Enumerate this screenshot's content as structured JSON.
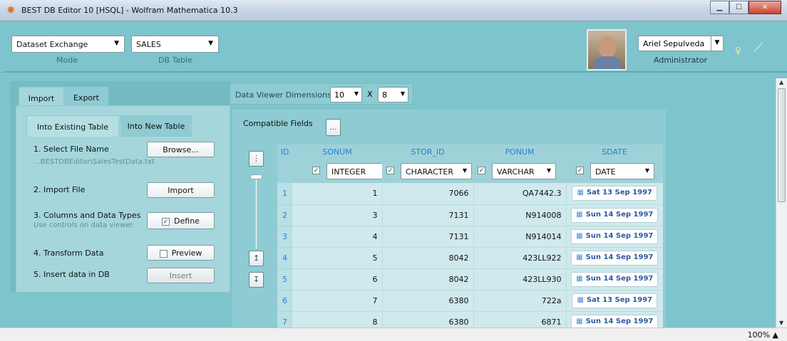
{
  "window": {
    "title": "BEST DB Editor 10 [HSQL] - Wolfram Mathematica 10.3"
  },
  "header": {
    "mode_value": "Dataset Exchange",
    "mode_caption": "Mode",
    "table_value": "SALES",
    "table_caption": "DB Table",
    "user_name": "Ariel Sepulveda",
    "user_role": "Administrator"
  },
  "left": {
    "tabs": [
      "Import",
      "Export"
    ],
    "subtabs": [
      "Into Existing Table",
      "Into New Table"
    ],
    "steps": [
      {
        "label": "1.  Select File Name",
        "button": "Browse..."
      },
      {
        "label": "2.  Import File",
        "button": "Import"
      },
      {
        "label": "3.  Columns and Data Types",
        "button": "Define"
      },
      {
        "label": "4.  Transform Data",
        "button": "Preview"
      },
      {
        "label": "5.  Insert data in DB",
        "button": "Insert"
      }
    ],
    "file_path": "...BESTDBEditor\\SalesTestData.txt",
    "hint": "Use controls on data viewer.",
    "define_checked": true,
    "preview_checked": false
  },
  "viewer": {
    "dims_label": "Data Viewer Dimensions",
    "rows": "10",
    "x_label": "X",
    "cols": "8",
    "compatible_label": "Compatible Fields",
    "dots": "...",
    "up_arrow": "↥",
    "down_arrow": "↧"
  },
  "grid": {
    "id_header": "ID",
    "columns": [
      {
        "name": "SONUM",
        "type": "INTEGER"
      },
      {
        "name": "STOR_ID",
        "type": "CHARACTER"
      },
      {
        "name": "PONUM",
        "type": "VARCHAR"
      },
      {
        "name": "SDATE",
        "type": "DATE"
      }
    ],
    "rows": [
      {
        "id": "1",
        "sonum": "1",
        "stor": "7066",
        "ponum": "QA7442.3",
        "sdate": "Sat 13 Sep 1997"
      },
      {
        "id": "2",
        "sonum": "3",
        "stor": "7131",
        "ponum": "N914008",
        "sdate": "Sun 14 Sep 1997"
      },
      {
        "id": "3",
        "sonum": "4",
        "stor": "7131",
        "ponum": "N914014",
        "sdate": "Sun 14 Sep 1997"
      },
      {
        "id": "4",
        "sonum": "5",
        "stor": "8042",
        "ponum": "423LL922",
        "sdate": "Sun 14 Sep 1997"
      },
      {
        "id": "5",
        "sonum": "6",
        "stor": "8042",
        "ponum": "423LL930",
        "sdate": "Sun 14 Sep 1997"
      },
      {
        "id": "6",
        "sonum": "7",
        "stor": "6380",
        "ponum": "722a",
        "sdate": "Sat 13 Sep 1997"
      },
      {
        "id": "7",
        "sonum": "8",
        "stor": "6380",
        "ponum": "6871",
        "sdate": "Sun 14 Sep 1997"
      }
    ]
  },
  "status": {
    "zoom": "100%"
  },
  "icons": {
    "app": "sunburst-icon",
    "bulb": "lightbulb-icon",
    "plug": "connection-icon",
    "calendar": "calendar-icon"
  }
}
